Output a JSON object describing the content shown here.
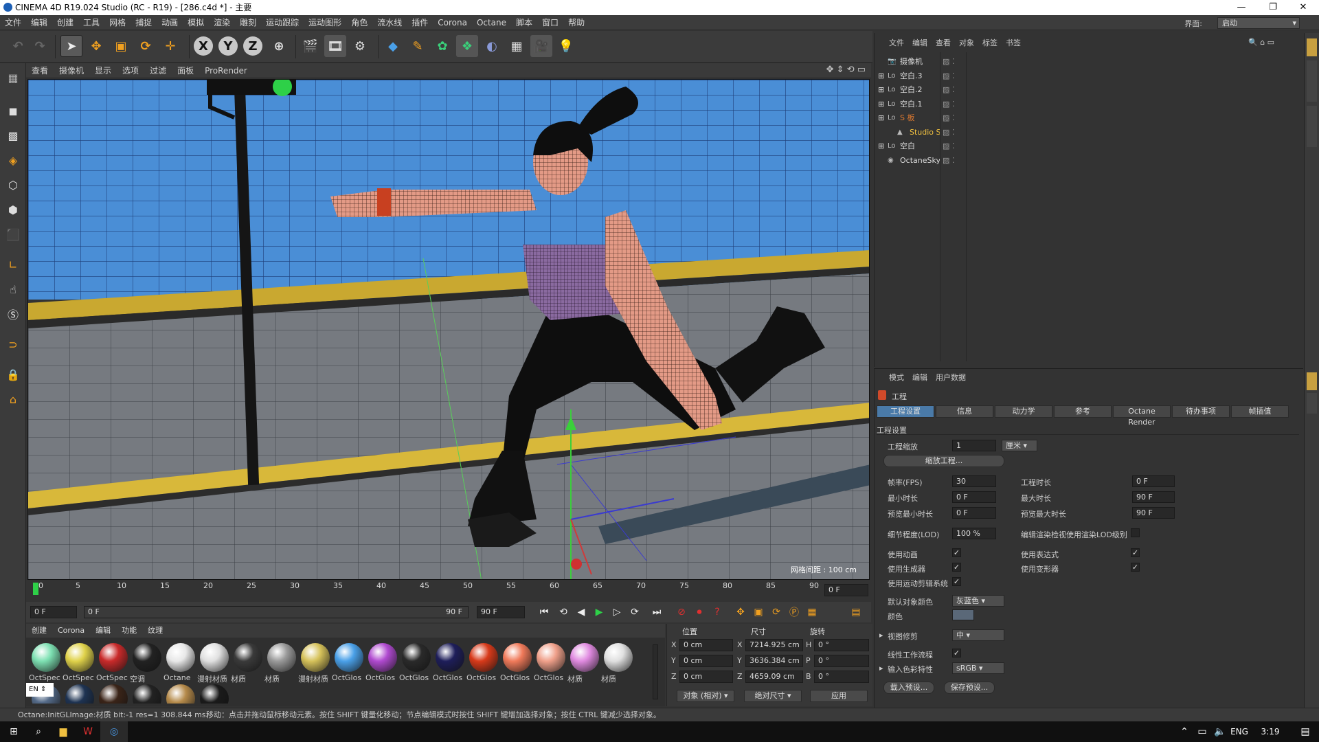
{
  "window": {
    "title": "CINEMA 4D R19.024 Studio (RC - R19) - [286.c4d *] - 主要",
    "min": "—",
    "max": "❐",
    "close": "✕"
  },
  "menu": [
    "文件",
    "编辑",
    "创建",
    "工具",
    "网格",
    "捕捉",
    "动画",
    "模拟",
    "渲染",
    "雕刻",
    "运动跟踪",
    "运动图形",
    "角色",
    "流水线",
    "插件",
    "Corona",
    "Octane",
    "脚本",
    "窗口",
    "帮助"
  ],
  "layout": {
    "label": "界面:",
    "value": "启动"
  },
  "toolbar": {
    "axis_x": "X",
    "axis_y": "Y",
    "axis_z": "Z"
  },
  "viewport": {
    "menu": [
      "查看",
      "摄像机",
      "显示",
      "选项",
      "过滤",
      "面板",
      "ProRender"
    ],
    "grid_spacing": "网格间距 : 100 cm"
  },
  "timeline": {
    "ticks": [
      "0",
      "5",
      "10",
      "15",
      "20",
      "25",
      "30",
      "35",
      "40",
      "45",
      "50",
      "55",
      "60",
      "65",
      "70",
      "75",
      "80",
      "85",
      "90"
    ],
    "end_field": "0 F",
    "current": "0 F",
    "range_start": "0 F",
    "range_end": "90 F",
    "max": "90 F"
  },
  "materials": {
    "menu": [
      "创建",
      "Corona",
      "编辑",
      "功能",
      "纹理"
    ],
    "items": [
      {
        "label": "OctSpec",
        "color": "#7de0b2"
      },
      {
        "label": "OctSpec",
        "color": "#e0d24a"
      },
      {
        "label": "OctSpec",
        "color": "#c92a2a"
      },
      {
        "label": "空调",
        "color": "#222222"
      },
      {
        "label": "Octane",
        "color": "#e8e8e8"
      },
      {
        "label": "漫射材质",
        "color": "#e0e0e0"
      },
      {
        "label": "材质",
        "color": "#3a3a3a"
      },
      {
        "label": "材质",
        "color": "#9a9a9a"
      },
      {
        "label": "漫射材质",
        "color": "#d6c25a"
      },
      {
        "label": "OctGlos",
        "color": "#4aa0e8"
      },
      {
        "label": "OctGlos",
        "color": "#b04ad0"
      },
      {
        "label": "OctGlos",
        "color": "#2a2a2a"
      },
      {
        "label": "OctGlos",
        "color": "#1e1e5a"
      },
      {
        "label": "OctGlos",
        "color": "#d83a1a"
      },
      {
        "label": "OctGlos",
        "color": "#f07a5a"
      },
      {
        "label": "OctGlos",
        "color": "#f0a08a"
      },
      {
        "label": "材质",
        "color": "#e08ae0"
      },
      {
        "label": "材质",
        "color": "#e0e0e0"
      }
    ],
    "row2": [
      "#546a88",
      "#1e3352",
      "#3a2418",
      "#222222",
      "#b58a4a",
      "#1a1a1a"
    ],
    "lang": "EN"
  },
  "coords": {
    "headers": [
      "位置",
      "尺寸",
      "旋转"
    ],
    "pos": [
      {
        "axis": "X",
        "value": "0 cm"
      },
      {
        "axis": "Y",
        "value": "0 cm"
      },
      {
        "axis": "Z",
        "value": "0 cm"
      }
    ],
    "size": [
      {
        "axis": "X",
        "value": "7214.925 cm"
      },
      {
        "axis": "Y",
        "value": "3636.384 cm"
      },
      {
        "axis": "Z",
        "value": "4659.09 cm"
      }
    ],
    "rot": [
      {
        "axis": "H",
        "value": "0 °"
      },
      {
        "axis": "P",
        "value": "0 °"
      },
      {
        "axis": "B",
        "value": "0 °"
      }
    ],
    "mode": "对象 (相对)",
    "size_mode": "绝对尺寸",
    "apply": "应用"
  },
  "objects": {
    "menu": [
      "文件",
      "编辑",
      "查看",
      "对象",
      "标签",
      "书签"
    ],
    "rows": [
      {
        "name": "摄像机",
        "color": "#dddddd"
      },
      {
        "name": "空白.3",
        "color": "#dddddd"
      },
      {
        "name": "空白.2",
        "color": "#dddddd"
      },
      {
        "name": "空白.1",
        "color": "#dddddd"
      },
      {
        "name": "S 板",
        "color": "#e07a30"
      },
      {
        "name": "Studio S",
        "color": "#f0c040"
      },
      {
        "name": "空白",
        "color": "#dddddd"
      },
      {
        "name": "OctaneSky",
        "color": "#dddddd"
      }
    ]
  },
  "attributes": {
    "menu": [
      "模式",
      "编辑",
      "用户数据"
    ],
    "title": "工程",
    "tabs": [
      "工程设置",
      "信息",
      "动力学",
      "参考",
      "Octane Render",
      "待办事项",
      "帧插值"
    ],
    "section": "工程设置",
    "scale_label": "工程缩放",
    "scale_value": "1",
    "scale_unit": "厘米",
    "scale_button": "缩放工程...",
    "fps_label": "帧率(FPS)",
    "fps_value": "30",
    "doc_time_label": "工程时长",
    "doc_time_value": "0 F",
    "min_time_label": "最小时长",
    "min_time_value": "0 F",
    "max_time_label": "最大时长",
    "max_time_value": "90 F",
    "preview_min_label": "预览最小时长",
    "preview_min_value": "0 F",
    "preview_max_label": "预览最大时长",
    "preview_max_value": "90 F",
    "lod_label": "细节程度(LOD)",
    "lod_value": "100 %",
    "render_lod_label": "编辑渲染检视使用渲染LOD级别",
    "use_anim_label": "使用动画",
    "use_expr_label": "使用表达式",
    "use_gen_label": "使用生成器",
    "use_deform_label": "使用变形器",
    "use_motion_label": "使用运动剪辑系统",
    "default_color_label": "默认对象颜色",
    "default_color_value": "灰蓝色",
    "color_label": "颜色",
    "view_clip_label": "视图修剪",
    "view_clip_value": "中",
    "linear_label": "线性工作流程",
    "input_color_label": "输入色彩特性",
    "input_color_value": "sRGB",
    "load_preset": "载入预设...",
    "save_preset": "保存预设..."
  },
  "status": {
    "left": "Octane:InitGLImage:材质  bit:-1 res=1  308.844 ms.",
    "message": "移动：点击并拖动鼠标移动元素。按住 SHIFT 键量化移动；节点编辑模式时按住 SHIFT 键增加选择对象；按住 CTRL 键减少选择对象。"
  },
  "taskbar": {
    "lang": "ENG",
    "time": "3:19"
  }
}
